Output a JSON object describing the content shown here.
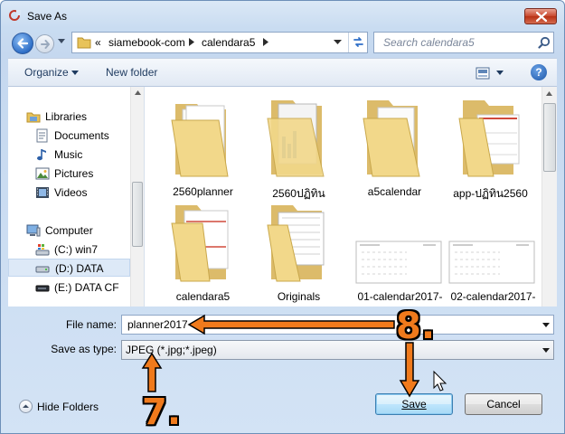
{
  "window": {
    "title": "Save As",
    "close_label": "✕"
  },
  "address": {
    "overflow": "«",
    "segments": [
      "siamebook-com",
      "calendara5"
    ],
    "search_placeholder": "Search calendara5"
  },
  "toolbar": {
    "organize_label": "Organize",
    "new_folder_label": "New folder",
    "help_label": "?"
  },
  "nav_pane": {
    "items": [
      {
        "label": "Libraries",
        "icon": "libraries-icon"
      },
      {
        "label": "Documents",
        "icon": "documents-icon"
      },
      {
        "label": "Music",
        "icon": "music-icon"
      },
      {
        "label": "Pictures",
        "icon": "pictures-icon"
      },
      {
        "label": "Videos",
        "icon": "videos-icon"
      },
      {
        "label": "Computer",
        "icon": "computer-icon"
      },
      {
        "label": "(C:) win7",
        "icon": "drive-c-icon"
      },
      {
        "label": "(D:) DATA",
        "icon": "drive-d-icon",
        "selected": true
      },
      {
        "label": "(E:) DATA CF",
        "icon": "drive-e-icon"
      }
    ]
  },
  "files": [
    {
      "label": "2560planner",
      "kind": "folder"
    },
    {
      "label": "2560ปฏิทิน",
      "kind": "folder"
    },
    {
      "label": "a5calendar",
      "kind": "folder"
    },
    {
      "label": "app-ปฏิทิน2560",
      "kind": "folder"
    },
    {
      "label": "calendara5",
      "kind": "folder"
    },
    {
      "label": "Originals",
      "kind": "folder"
    },
    {
      "label": "01-calendar2017-",
      "kind": "image"
    },
    {
      "label": "02-calendar2017-",
      "kind": "image"
    }
  ],
  "form": {
    "file_name_label": "File name:",
    "file_name_value": "planner2017",
    "save_type_label": "Save as type:",
    "save_type_value": "JPEG (*.jpg;*.jpeg)"
  },
  "footer": {
    "hide_folders_label": "Hide Folders",
    "save_label": "Save",
    "cancel_label": "Cancel"
  },
  "annotations": {
    "step8": "8.",
    "step7": "7."
  },
  "colors": {
    "annotation": "#f07a1c",
    "selection": "#dde9f7"
  }
}
